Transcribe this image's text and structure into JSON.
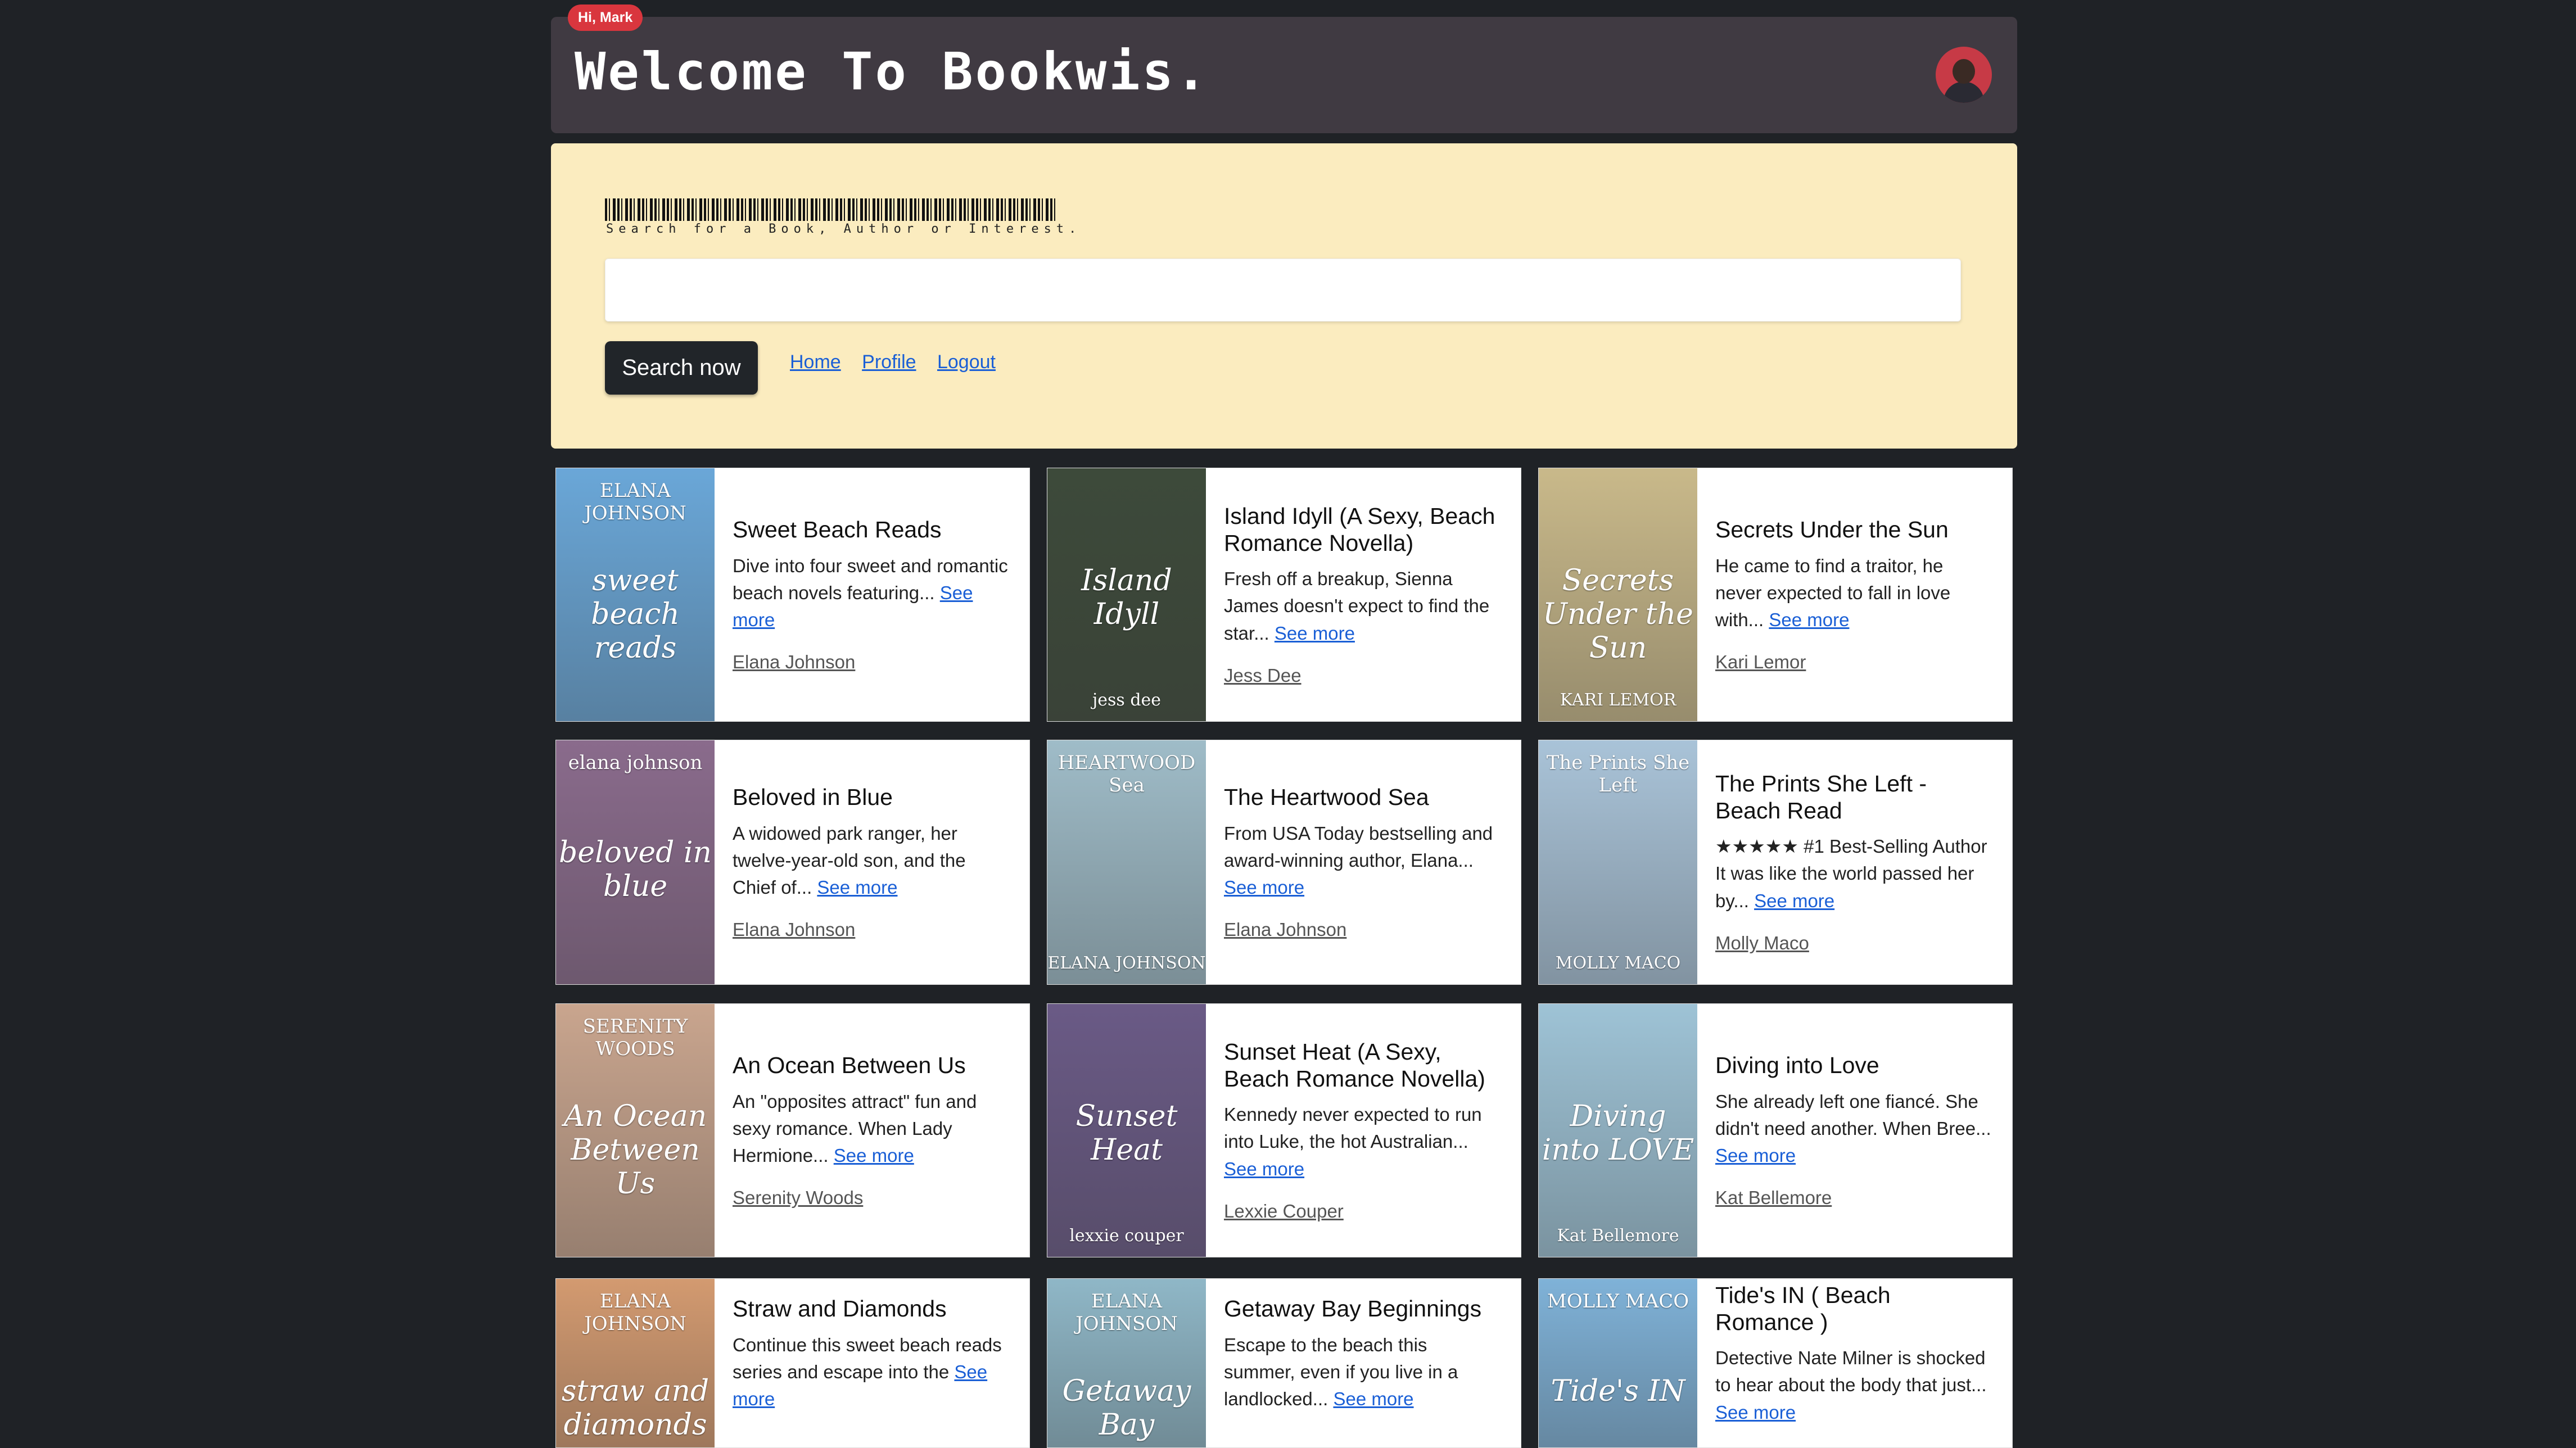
{
  "header": {
    "greeting": "Hi, Mark",
    "title": "Welcome To Bookwis."
  },
  "search": {
    "label": "Search for a Book, Author or Interest.",
    "value": "",
    "placeholder": "",
    "button": "Search now"
  },
  "nav": {
    "home": "Home",
    "profile": "Profile",
    "logout": "Logout"
  },
  "see_more": "See more",
  "books": [
    {
      "title": "Sweet Beach Reads",
      "desc": "Dive into four sweet and romantic beach novels featuring...",
      "author": "Elana Johnson",
      "cover_color": "#6aa7d8",
      "cover_top": "ELANA JOHNSON",
      "cover_mid": "sweet beach reads",
      "cover_bot": ""
    },
    {
      "title": "Island Idyll (A Sexy, Beach Romance Novella)",
      "desc": "Fresh off a breakup, Sienna James doesn't expect to find the star...",
      "author": "Jess Dee",
      "cover_color": "#3d4a3a",
      "cover_top": "",
      "cover_mid": "Island Idyll",
      "cover_bot": "jess dee"
    },
    {
      "title": "Secrets Under the Sun",
      "desc": "He came to find a traitor, he never expected to fall in love with...",
      "author": "Kari Lemor",
      "cover_color": "#c9b98a",
      "cover_top": "",
      "cover_mid": "Secrets Under the Sun",
      "cover_bot": "KARI LEMOR"
    },
    {
      "title": "Beloved in Blue",
      "desc": "A widowed park ranger, her twelve-year-old son, and the Chief of...",
      "author": "Elana Johnson",
      "cover_color": "#8a6b8c",
      "cover_top": "elana johnson",
      "cover_mid": "beloved in blue",
      "cover_bot": ""
    },
    {
      "title": "The Heartwood Sea",
      "desc": "From USA Today bestselling and award-winning author, Elana...",
      "author": "Elana Johnson",
      "cover_color": "#9fbcc8",
      "cover_top": "HEARTWOOD Sea",
      "cover_mid": "",
      "cover_bot": "ELANA JOHNSON"
    },
    {
      "title": "The Prints She Left - Beach Read",
      "desc": "★★★★★ #1 Best-Selling Author It was like the world passed her by...",
      "author": "Molly Maco",
      "cover_color": "#a9c3d8",
      "cover_top": "The Prints She Left",
      "cover_mid": "",
      "cover_bot": "MOLLY MACO"
    },
    {
      "title": "An Ocean Between Us",
      "desc": "An \"opposites attract\" fun and sexy romance. When Lady Hermione...",
      "author": "Serenity Woods",
      "cover_color": "#c9a58e",
      "cover_top": "SERENITY WOODS",
      "cover_mid": "An Ocean Between Us",
      "cover_bot": ""
    },
    {
      "title": "Sunset Heat (A Sexy, Beach Romance Novella)",
      "desc": "Kennedy never expected to run into Luke, the hot Australian...",
      "author": "Lexxie Couper",
      "cover_color": "#6a5a86",
      "cover_top": "",
      "cover_mid": "Sunset Heat",
      "cover_bot": "lexxie couper"
    },
    {
      "title": "Diving into Love",
      "desc": "She already left one fiancé. She didn't need another. When Bree...",
      "author": "Kat Bellemore",
      "cover_color": "#9ec3d6",
      "cover_top": "",
      "cover_mid": "Diving into LOVE",
      "cover_bot": "Kat Bellemore"
    },
    {
      "title": "Straw and Diamonds",
      "desc": "Continue this sweet beach reads series and escape into the",
      "author": "",
      "cover_color": "#d39a70",
      "cover_top": "ELANA JOHNSON",
      "cover_mid": "straw and diamonds",
      "cover_bot": ""
    },
    {
      "title": "Getaway Bay Beginnings",
      "desc": "Escape to the beach this summer, even if you live in a landlocked...",
      "author": "",
      "cover_color": "#8fb7c7",
      "cover_top": "ELANA JOHNSON",
      "cover_mid": "Getaway Bay",
      "cover_bot": ""
    },
    {
      "title": "Tide's IN ( Beach Romance )",
      "desc": "Detective Nate Milner is shocked to hear about the body that just...",
      "author": "",
      "cover_color": "#7fb2d8",
      "cover_top": "MOLLY MACO",
      "cover_mid": "Tide's IN",
      "cover_bot": ""
    }
  ]
}
